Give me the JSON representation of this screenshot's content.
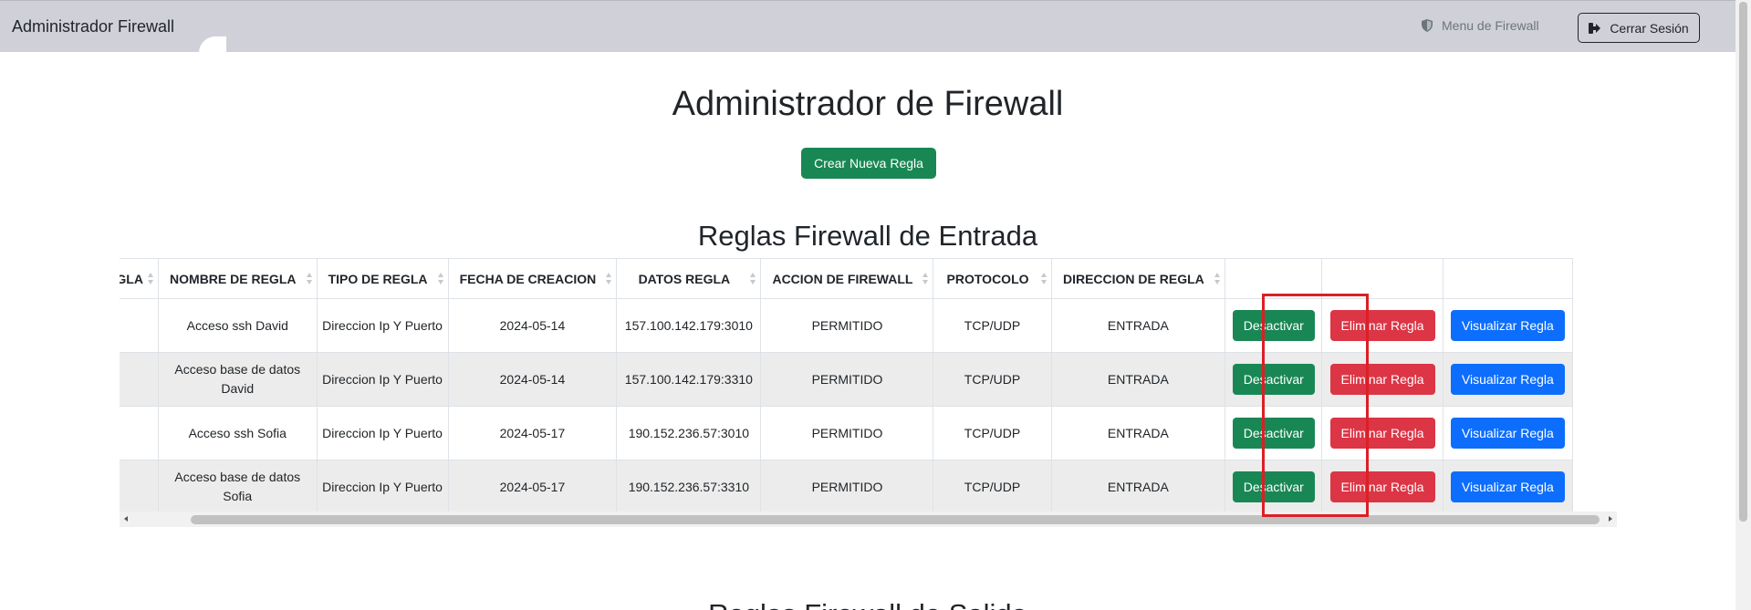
{
  "navbar": {
    "brand": "Administrador Firewall",
    "menu_label": "Menu de Firewall",
    "logout_label": "Cerrar Sesión"
  },
  "page": {
    "title": "Administrador de Firewall",
    "create_button": "Crear Nueva Regla",
    "inbound_title": "Reglas Firewall de Entrada",
    "outbound_title": "Reglas Firewall de Salida"
  },
  "table": {
    "headers": [
      "ID REGLA",
      "NOMBRE DE REGLA",
      "TIPO DE REGLA",
      "FECHA DE CREACION",
      "DATOS REGLA",
      "ACCION DE FIREWALL",
      "PROTOCOLO",
      "DIRECCION DE REGLA",
      "",
      "",
      ""
    ],
    "rows": [
      {
        "id": "",
        "name": "Acceso ssh David",
        "type": "Direccion Ip Y Puerto",
        "date": "2024-05-14",
        "data": "157.100.142.179:3010",
        "action": "PERMITIDO",
        "protocol": "TCP/UDP",
        "direction": "ENTRADA"
      },
      {
        "id": "",
        "name": "Acceso base de datos David",
        "type": "Direccion Ip Y Puerto",
        "date": "2024-05-14",
        "data": "157.100.142.179:3310",
        "action": "PERMITIDO",
        "protocol": "TCP/UDP",
        "direction": "ENTRADA"
      },
      {
        "id": "",
        "name": "Acceso ssh Sofia",
        "type": "Direccion Ip Y Puerto",
        "date": "2024-05-17",
        "data": "190.152.236.57:3010",
        "action": "PERMITIDO",
        "protocol": "TCP/UDP",
        "direction": "ENTRADA"
      },
      {
        "id": "",
        "name": "Acceso base de datos Sofia",
        "type": "Direccion Ip Y Puerto",
        "date": "2024-05-17",
        "data": "190.152.236.57:3310",
        "action": "PERMITIDO",
        "protocol": "TCP/UDP",
        "direction": "ENTRADA"
      }
    ],
    "btn_deactivate": "Desactivar",
    "btn_delete": "Eliminar Regla",
    "btn_view": "Visualizar Regla"
  },
  "colors": {
    "navbar_bg": "#d0d1d8",
    "success": "#198754",
    "danger": "#dc3545",
    "primary": "#0d6efd",
    "highlight": "#dc1f26"
  }
}
